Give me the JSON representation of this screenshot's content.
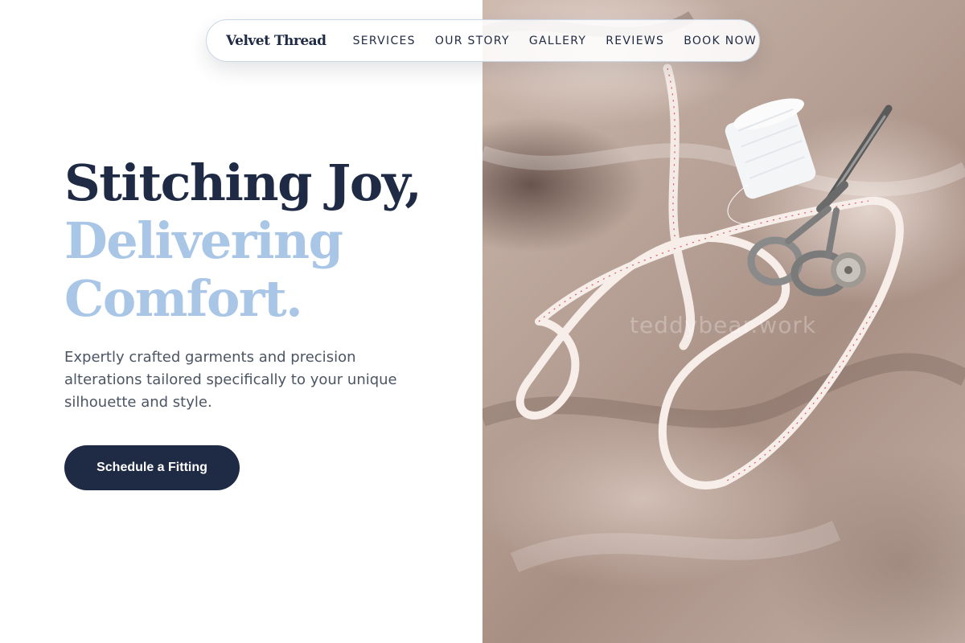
{
  "nav": {
    "brand": "Velvet Thread",
    "links": [
      "SERVICES",
      "OUR STORY",
      "GALLERY",
      "REVIEWS",
      "BOOK NOW"
    ]
  },
  "hero": {
    "title_line1": "Stitching Joy,",
    "title_line2": "Delivering",
    "title_line3": "Comfort.",
    "description": "Expertly crafted garments and precision alterations tailored specifically to your unique silhouette and style.",
    "cta_label": "Schedule a Fitting"
  },
  "image": {
    "watermark": "teddybear.work",
    "subject": "fabric-with-tailoring-tools"
  },
  "colors": {
    "primary": "#1f2a44",
    "accent": "#a9c6e6",
    "body_text": "#4b5563",
    "background": "#ffffff"
  }
}
